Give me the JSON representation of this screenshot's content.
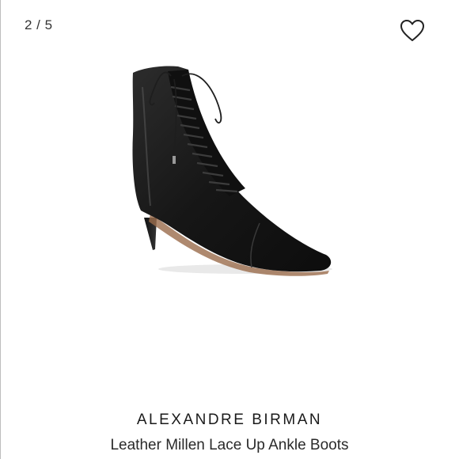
{
  "gallery": {
    "counter": "2 / 5"
  },
  "product": {
    "brand": "ALEXANDRE BIRMAN",
    "title": "Leather Millen Lace Up Ankle Boots",
    "image_subject": "black leather lace-up pointed-toe kitten-heel ankle boot"
  },
  "icons": {
    "favorite": "heart-outline-icon"
  },
  "colors": {
    "text": "#222222",
    "boot": "#1b1b1b",
    "background": "#ffffff"
  }
}
